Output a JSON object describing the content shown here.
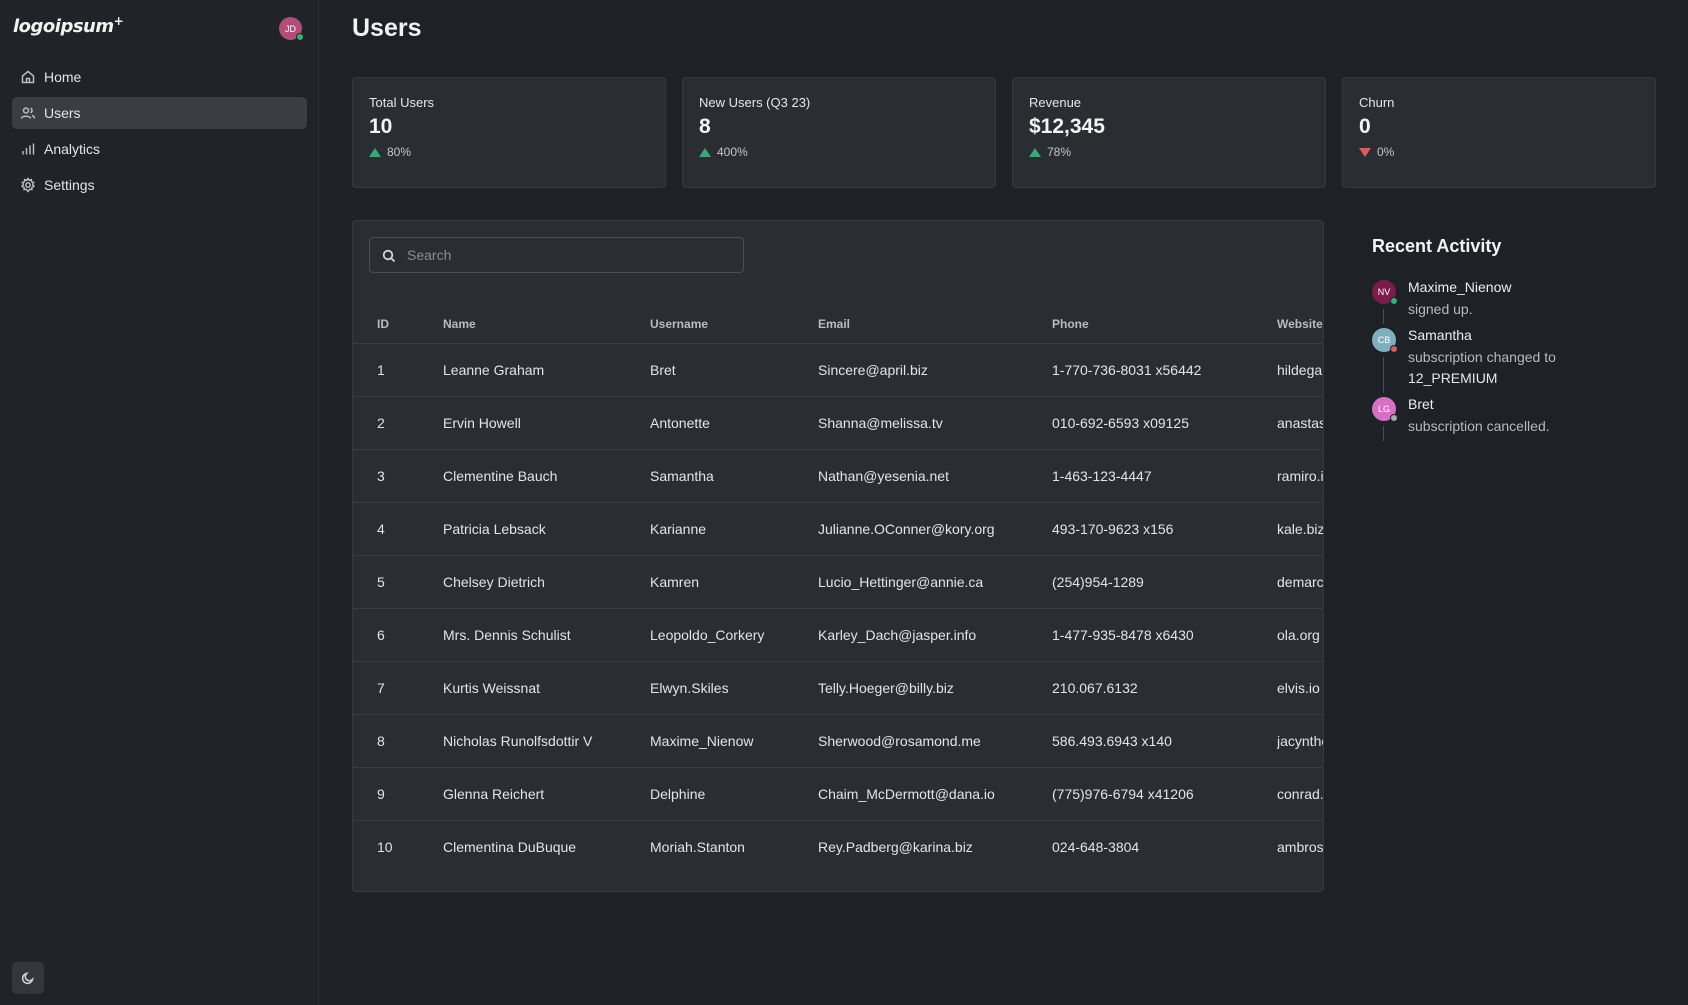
{
  "app": {
    "logo": "logoipsum",
    "logo_mark": "+",
    "avatar_initials": "JD",
    "avatar_color": "#b14d77",
    "status_color": "#2fb36d"
  },
  "sidebar": {
    "items": [
      {
        "label": "Home",
        "icon": "home-icon"
      },
      {
        "label": "Users",
        "icon": "users-icon",
        "active": true
      },
      {
        "label": "Analytics",
        "icon": "bar-chart-icon"
      },
      {
        "label": "Settings",
        "icon": "gear-icon"
      }
    ],
    "theme_toggle_icon": "moon-icon"
  },
  "page": {
    "title": "Users"
  },
  "stats": [
    {
      "label": "Total Users",
      "value": "10",
      "change": "80%",
      "trend": "up"
    },
    {
      "label": "New Users (Q3 23)",
      "value": "8",
      "change": "400%",
      "trend": "up"
    },
    {
      "label": "Revenue",
      "value": "$12,345",
      "change": "78%",
      "trend": "up"
    },
    {
      "label": "Churn",
      "value": "0",
      "change": "0%",
      "trend": "down"
    }
  ],
  "search": {
    "placeholder": "Search",
    "value": ""
  },
  "table": {
    "columns": [
      "ID",
      "Name",
      "Username",
      "Email",
      "Phone",
      "Website"
    ],
    "rows": [
      [
        "1",
        "Leanne Graham",
        "Bret",
        "Sincere@april.biz",
        "1-770-736-8031 x56442",
        "hildegard.org"
      ],
      [
        "2",
        "Ervin Howell",
        "Antonette",
        "Shanna@melissa.tv",
        "010-692-6593 x09125",
        "anastasia.net"
      ],
      [
        "3",
        "Clementine Bauch",
        "Samantha",
        "Nathan@yesenia.net",
        "1-463-123-4447",
        "ramiro.info"
      ],
      [
        "4",
        "Patricia Lebsack",
        "Karianne",
        "Julianne.OConner@kory.org",
        "493-170-9623 x156",
        "kale.biz"
      ],
      [
        "5",
        "Chelsey Dietrich",
        "Kamren",
        "Lucio_Hettinger@annie.ca",
        "(254)954-1289",
        "demarco.info"
      ],
      [
        "6",
        "Mrs. Dennis Schulist",
        "Leopoldo_Corkery",
        "Karley_Dach@jasper.info",
        "1-477-935-8478 x6430",
        "ola.org"
      ],
      [
        "7",
        "Kurtis Weissnat",
        "Elwyn.Skiles",
        "Telly.Hoeger@billy.biz",
        "210.067.6132",
        "elvis.io"
      ],
      [
        "8",
        "Nicholas Runolfsdottir V",
        "Maxime_Nienow",
        "Sherwood@rosamond.me",
        "586.493.6943 x140",
        "jacynthe.com"
      ],
      [
        "9",
        "Glenna Reichert",
        "Delphine",
        "Chaim_McDermott@dana.io",
        "(775)976-6794 x41206",
        "conrad.com"
      ],
      [
        "10",
        "Clementina DuBuque",
        "Moriah.Stanton",
        "Rey.Padberg@karina.biz",
        "024-648-3804",
        "ambrose.net"
      ]
    ]
  },
  "recent_activity": {
    "title": "Recent Activity",
    "items": [
      {
        "initials": "NV",
        "avatar_color": "#7b1d4a",
        "status_color": "#2fb36d",
        "name": "Maxime_Nienow",
        "text": "signed up.",
        "highlight": ""
      },
      {
        "initials": "CB",
        "avatar_color": "#7fb0c0",
        "status_color": "#dc5b5b",
        "name": "Samantha",
        "text": "subscription changed to",
        "highlight": "12_PREMIUM"
      },
      {
        "initials": "LG",
        "avatar_color": "#d86fc6",
        "status_color": "#a8abaf",
        "name": "Bret",
        "text": "subscription cancelled.",
        "highlight": ""
      }
    ]
  }
}
